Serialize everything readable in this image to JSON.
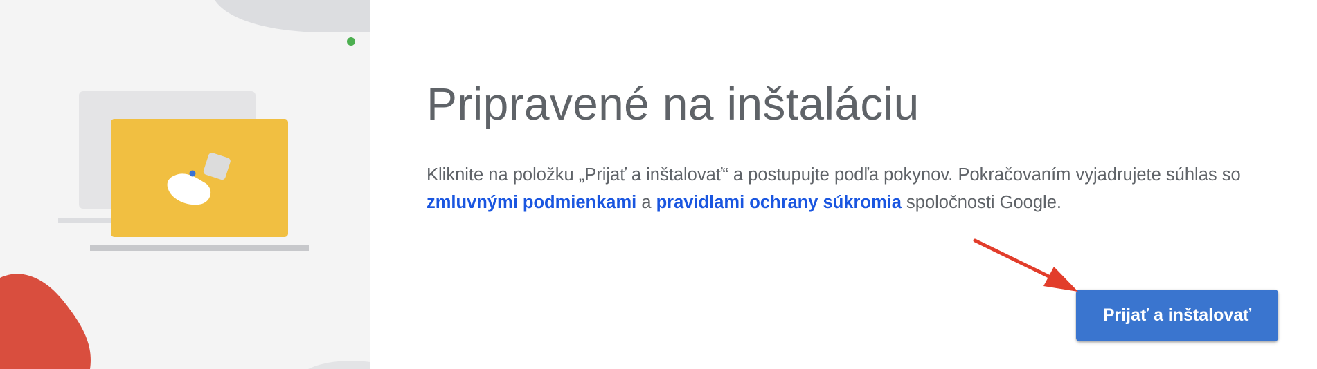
{
  "main": {
    "title": "Pripravené na inštaláciu",
    "description_start": "Kliknite na položku „Prijať a inštalovať“ a postupujte podľa pokynov. Pokračovaním vyjadrujete súhlas so ",
    "terms_link": "zmluvnými podmienkami",
    "description_and": " a ",
    "privacy_link": "pravidlami ochrany súkromia",
    "description_end": " spoločnosti Google."
  },
  "actions": {
    "install_button_label": "Prijať a inštalovať"
  },
  "colors": {
    "accent": "#3a75cf",
    "link": "#1a56e0",
    "text": "#5f6368",
    "illustration_laptop": "#f1bf41",
    "annotation_arrow": "#e23d2b"
  }
}
